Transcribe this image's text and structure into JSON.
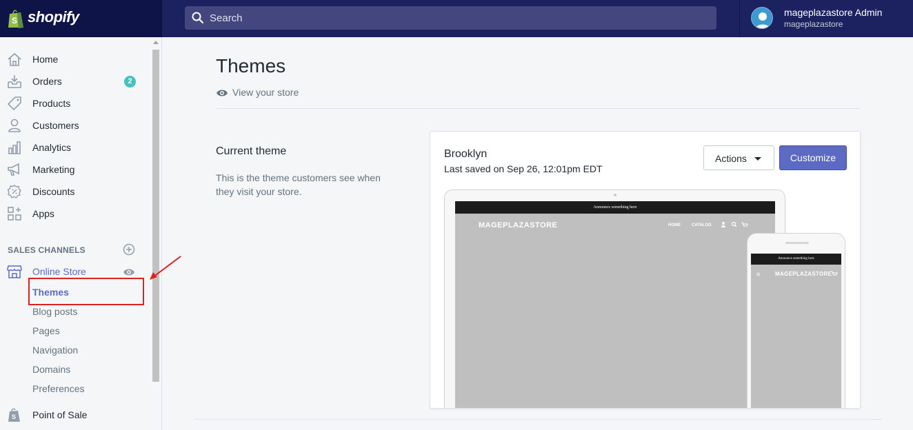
{
  "app": {
    "brand": "shopify",
    "search_placeholder": "Search",
    "user": {
      "name": "mageplazastore Admin",
      "store": "mageplazastore"
    },
    "colors": {
      "topbar": "#1c2260",
      "accent": "#5c6ac4",
      "badge": "#47c1bf",
      "annotation": "#e02020"
    }
  },
  "sidebar": {
    "items": [
      {
        "label": "Home",
        "icon": "home-icon"
      },
      {
        "label": "Orders",
        "icon": "orders-icon",
        "badge": "2"
      },
      {
        "label": "Products",
        "icon": "tag-icon"
      },
      {
        "label": "Customers",
        "icon": "customer-icon"
      },
      {
        "label": "Analytics",
        "icon": "analytics-icon"
      },
      {
        "label": "Marketing",
        "icon": "megaphone-icon"
      },
      {
        "label": "Discounts",
        "icon": "discount-icon"
      },
      {
        "label": "Apps",
        "icon": "apps-icon"
      }
    ],
    "sales_channels_title": "SALES CHANNELS",
    "online_store": {
      "label": "Online Store",
      "sub_items": [
        "Themes",
        "Blog posts",
        "Pages",
        "Navigation",
        "Domains",
        "Preferences"
      ],
      "active": "Themes"
    },
    "point_of_sale": "Point of Sale"
  },
  "main": {
    "title": "Themes",
    "view_store": "View your store",
    "current_theme": {
      "heading": "Current theme",
      "description": "This is the theme customers see when they visit your store.",
      "name": "Brooklyn",
      "saved": "Last saved on Sep 26, 12:01pm EDT",
      "actions_label": "Actions",
      "customize_label": "Customize"
    },
    "preview": {
      "announcement": "Announce something here",
      "store_name": "MAGEPLAZASTORE",
      "nav": [
        "HOME",
        "CATALOG"
      ],
      "menu_glyph": "≡"
    }
  }
}
